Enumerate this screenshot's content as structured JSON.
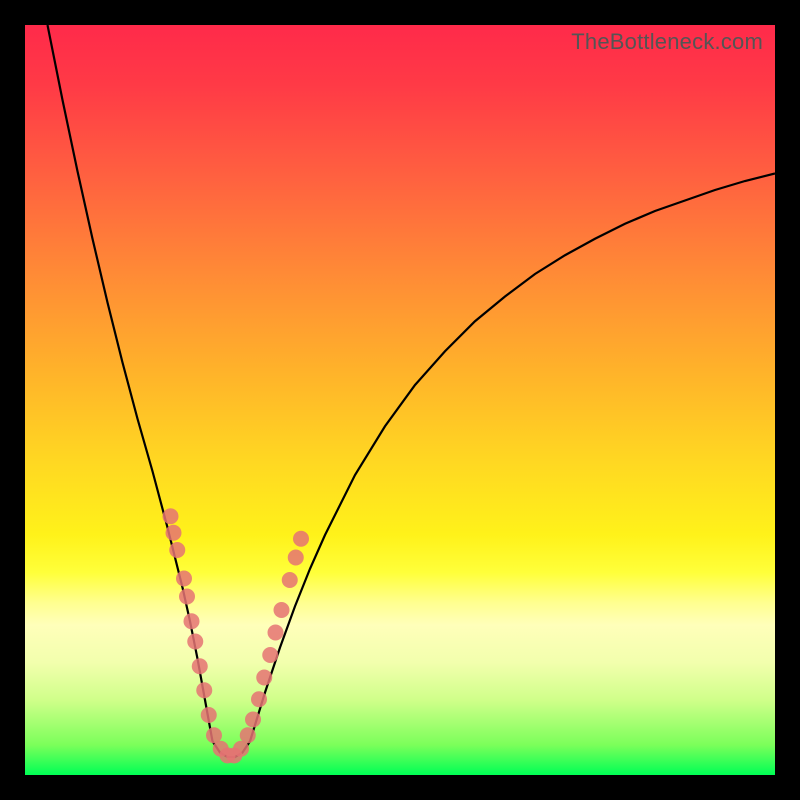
{
  "watermark": "TheBottleneck.com",
  "chart_data": {
    "type": "line",
    "title": "",
    "xlabel": "",
    "ylabel": "",
    "xlim": [
      0,
      100
    ],
    "ylim": [
      0,
      100
    ],
    "series": [
      {
        "name": "left-branch",
        "x": [
          3,
          5,
          7,
          9,
          11,
          13,
          15,
          17,
          19,
          21,
          22,
          23,
          24,
          25
        ],
        "y": [
          100,
          90,
          80.5,
          71.5,
          63,
          55,
          47.5,
          40.5,
          33,
          25,
          20.5,
          15.5,
          10,
          4.5
        ]
      },
      {
        "name": "valley-floor",
        "x": [
          25,
          26,
          27,
          28,
          29,
          30
        ],
        "y": [
          4.5,
          3,
          2.4,
          2.4,
          3,
          4.5
        ]
      },
      {
        "name": "right-branch",
        "x": [
          30,
          32,
          34,
          36,
          38,
          40,
          44,
          48,
          52,
          56,
          60,
          64,
          68,
          72,
          76,
          80,
          84,
          88,
          92,
          96,
          100
        ],
        "y": [
          4.5,
          11,
          17,
          22.5,
          27.5,
          32,
          40,
          46.5,
          52,
          56.5,
          60.5,
          63.8,
          66.8,
          69.3,
          71.5,
          73.5,
          75.2,
          76.6,
          78,
          79.2,
          80.2
        ]
      }
    ],
    "scatter": {
      "name": "highlight-points",
      "points": [
        {
          "x": 19.4,
          "y": 34.5
        },
        {
          "x": 19.8,
          "y": 32.3
        },
        {
          "x": 20.3,
          "y": 30.0
        },
        {
          "x": 21.2,
          "y": 26.2
        },
        {
          "x": 21.6,
          "y": 23.8
        },
        {
          "x": 22.2,
          "y": 20.5
        },
        {
          "x": 22.7,
          "y": 17.8
        },
        {
          "x": 23.3,
          "y": 14.5
        },
        {
          "x": 23.9,
          "y": 11.3
        },
        {
          "x": 24.5,
          "y": 8.0
        },
        {
          "x": 25.2,
          "y": 5.3
        },
        {
          "x": 26.1,
          "y": 3.5
        },
        {
          "x": 27.0,
          "y": 2.6
        },
        {
          "x": 27.9,
          "y": 2.6
        },
        {
          "x": 28.8,
          "y": 3.5
        },
        {
          "x": 29.7,
          "y": 5.3
        },
        {
          "x": 30.4,
          "y": 7.4
        },
        {
          "x": 31.2,
          "y": 10.1
        },
        {
          "x": 31.9,
          "y": 13.0
        },
        {
          "x": 32.7,
          "y": 16.0
        },
        {
          "x": 33.4,
          "y": 19.0
        },
        {
          "x": 34.2,
          "y": 22.0
        },
        {
          "x": 35.3,
          "y": 26.0
        },
        {
          "x": 36.1,
          "y": 29.0
        },
        {
          "x": 36.8,
          "y": 31.5
        }
      ]
    },
    "grid": false,
    "legend": false
  }
}
